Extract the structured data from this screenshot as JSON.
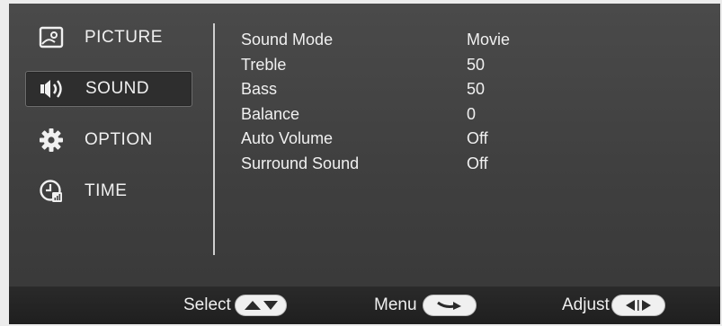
{
  "sidebar": {
    "items": [
      {
        "label": "PICTURE",
        "icon": "picture-icon",
        "selected": false
      },
      {
        "label": "SOUND",
        "icon": "speaker-icon",
        "selected": true
      },
      {
        "label": "OPTION",
        "icon": "gear-icon",
        "selected": false
      },
      {
        "label": "TIME",
        "icon": "clock-icon",
        "selected": false
      }
    ]
  },
  "settings": [
    {
      "label": "Sound Mode",
      "value": "Movie"
    },
    {
      "label": "Treble",
      "value": "50"
    },
    {
      "label": "Bass",
      "value": "50"
    },
    {
      "label": "Balance",
      "value": "0"
    },
    {
      "label": "Auto Volume",
      "value": "Off"
    },
    {
      "label": "Surround Sound",
      "value": "Off"
    }
  ],
  "footer": {
    "select_label": "Select",
    "menu_label": "Menu",
    "adjust_label": "Adjust"
  },
  "colors": {
    "panel": "#444444",
    "footer": "#242424",
    "text": "#f0f0f0"
  }
}
